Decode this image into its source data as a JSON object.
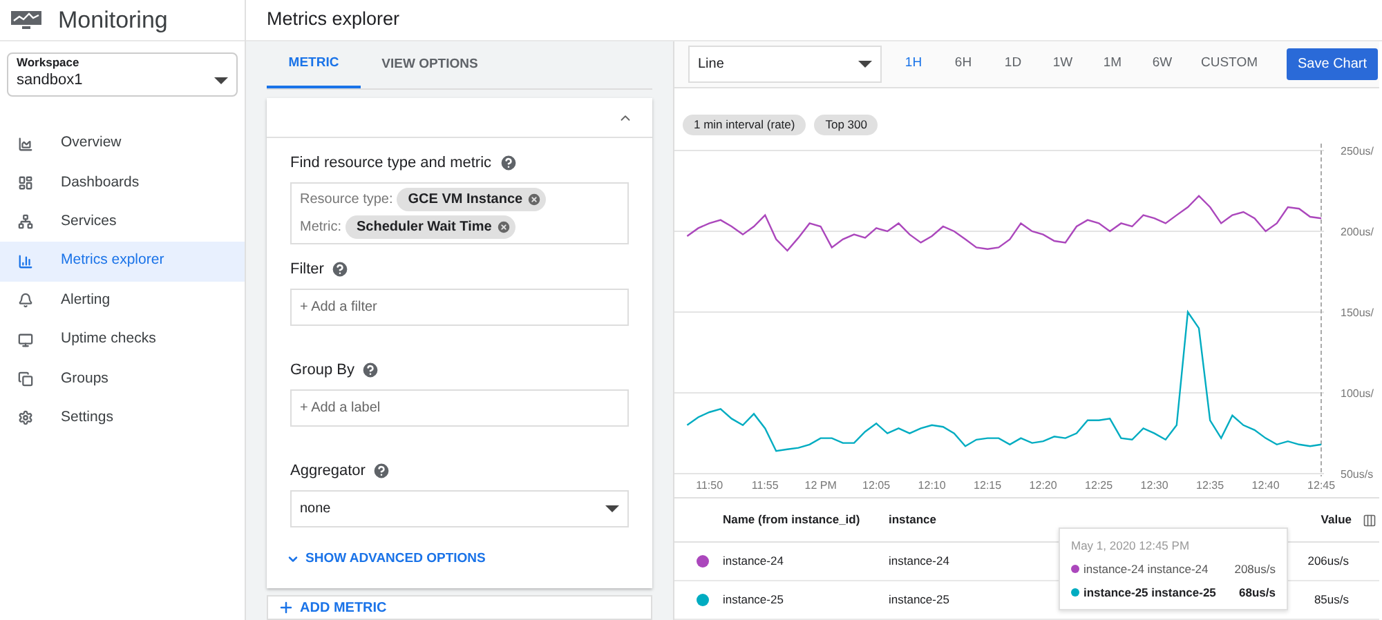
{
  "app": {
    "title": "Monitoring"
  },
  "page": {
    "title": "Metrics explorer"
  },
  "workspace": {
    "label": "Workspace",
    "value": "sandbox1"
  },
  "nav": [
    {
      "label": "Overview",
      "selected": false
    },
    {
      "label": "Dashboards",
      "selected": false
    },
    {
      "label": "Services",
      "selected": false
    },
    {
      "label": "Metrics explorer",
      "selected": true
    },
    {
      "label": "Alerting",
      "selected": false
    },
    {
      "label": "Uptime checks",
      "selected": false
    },
    {
      "label": "Groups",
      "selected": false
    },
    {
      "label": "Settings",
      "selected": false
    }
  ],
  "tabs": [
    {
      "label": "METRIC",
      "selected": true
    },
    {
      "label": "VIEW OPTIONS",
      "selected": false
    }
  ],
  "metric_card": {
    "expanded": true,
    "find": {
      "label": "Find resource type and metric",
      "rows": [
        {
          "label": "Resource type:",
          "value": "GCE VM Instance"
        },
        {
          "label": "Metric:",
          "value": "Scheduler Wait Time"
        }
      ]
    },
    "filter": {
      "label": "Filter",
      "placeholder": "+ Add a filter"
    },
    "group_by": {
      "label": "Group By",
      "placeholder": "+ Add a label"
    },
    "aggregator": {
      "label": "Aggregator",
      "value": "none"
    },
    "advanced": "SHOW ADVANCED OPTIONS"
  },
  "add_metric": "ADD METRIC",
  "chart_type": "Line",
  "ranges": [
    {
      "label": "1H",
      "selected": true
    },
    {
      "label": "6H",
      "selected": false
    },
    {
      "label": "1D",
      "selected": false
    },
    {
      "label": "1W",
      "selected": false
    },
    {
      "label": "1M",
      "selected": false
    },
    {
      "label": "6W",
      "selected": false
    },
    {
      "label": "CUSTOM",
      "selected": false
    }
  ],
  "save_button": "Save Chart",
  "chips": [
    "1 min interval (rate)",
    "Top 300"
  ],
  "chart_data": {
    "type": "line",
    "categories": [
      null,
      null,
      "11:50",
      null,
      null,
      null,
      null,
      "11:55",
      null,
      null,
      null,
      null,
      "12 PM",
      null,
      null,
      null,
      null,
      "12:05",
      null,
      null,
      null,
      null,
      "12:10",
      null,
      null,
      null,
      null,
      "12:15",
      null,
      null,
      null,
      null,
      "12:20",
      null,
      null,
      null,
      null,
      "12:25",
      null,
      null,
      null,
      null,
      "12:30",
      null,
      null,
      null,
      null,
      "12:35",
      null,
      null,
      null,
      null,
      "12:40",
      null,
      null,
      null,
      null,
      "12:45"
    ],
    "series": [
      {
        "color": "#ab47bc",
        "values": [
          197,
          202,
          205,
          207,
          203,
          198,
          203,
          210,
          195,
          188,
          196,
          205,
          203,
          190,
          195,
          198,
          196,
          202,
          200,
          205,
          198,
          193,
          197,
          203,
          200,
          195,
          190,
          189,
          190,
          195,
          205,
          200,
          198,
          194,
          193,
          203,
          207,
          205,
          200,
          205,
          203,
          210,
          208,
          205,
          210,
          215,
          222,
          215,
          205,
          210,
          212,
          208,
          200,
          205,
          215,
          214,
          209,
          208
        ]
      },
      {
        "color": "#00acc1",
        "values": [
          80,
          85,
          88,
          90,
          84,
          80,
          87,
          78,
          64,
          65,
          66,
          68,
          72,
          72,
          69,
          69,
          76,
          81,
          75,
          78,
          75,
          78,
          80,
          79,
          75,
          67,
          71,
          72,
          72,
          68,
          72,
          69,
          70,
          73,
          72,
          75,
          83,
          83,
          84,
          72,
          71,
          78,
          75,
          71,
          80,
          150,
          140,
          83,
          72,
          86,
          80,
          77,
          72,
          68,
          70,
          68,
          67,
          68
        ]
      }
    ],
    "ylim": [
      50,
      250
    ],
    "grid": true,
    "yticks": [
      {
        "value": 250,
        "label": "250us/"
      },
      {
        "value": 200,
        "label": "200us/"
      },
      {
        "value": 150,
        "label": "150us/"
      },
      {
        "value": 100,
        "label": "100us/"
      },
      {
        "value": 50,
        "label": "50us/s"
      }
    ]
  },
  "tooltip": {
    "title": "May 1, 2020 12:45 PM",
    "rows": [
      {
        "name": "instance-24 instance-24",
        "value": "208us/s",
        "color": "#ab47bc",
        "selected": false
      },
      {
        "name": "instance-25 instance-25",
        "value": "68us/s",
        "color": "#00acc1",
        "selected": true
      }
    ]
  },
  "table": {
    "columns": [
      "Name (from instance_id)",
      "instance",
      "Value"
    ],
    "rows": [
      {
        "color": "#ab47bc",
        "name": "instance-24",
        "column_2": "instance-24",
        "value": "206us/s"
      },
      {
        "color": "#00acc1",
        "name": "instance-25",
        "column_2": "instance-25",
        "value": "85us/s"
      }
    ]
  }
}
